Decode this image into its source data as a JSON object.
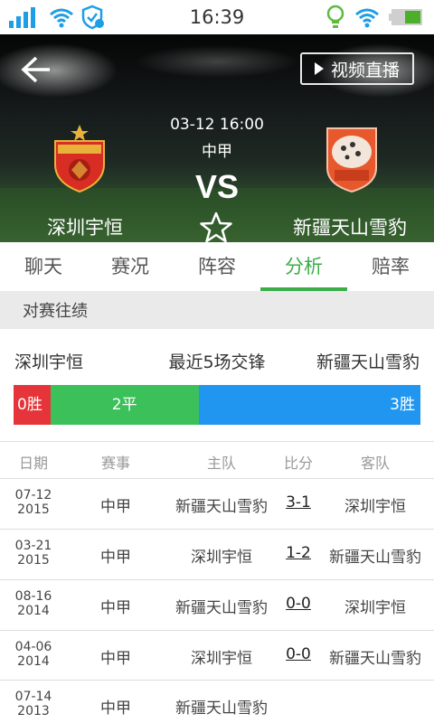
{
  "status_bar": {
    "time": "16:39"
  },
  "header": {
    "live_label": "视频直播",
    "match_time": "03-12 16:00",
    "league": "中甲",
    "vs": "VS",
    "home_team": "深圳宇恒",
    "away_team": "新疆天山雪豹"
  },
  "tabs": [
    {
      "label": "聊天",
      "active": false
    },
    {
      "label": "赛况",
      "active": false
    },
    {
      "label": "阵容",
      "active": false
    },
    {
      "label": "分析",
      "active": true
    },
    {
      "label": "赔率",
      "active": false
    }
  ],
  "section": {
    "title": "对赛往绩"
  },
  "summary": {
    "home": "深圳宇恒",
    "middle": "最近5场交锋",
    "away": "新疆天山雪豹"
  },
  "record": {
    "win_label": "0胜",
    "draw_label": "2平",
    "loss_label": "3胜",
    "wins": 0,
    "draws": 2,
    "losses": 3,
    "colors": {
      "win": "#e6353a",
      "draw": "#3cc05a",
      "loss": "#2196f0"
    }
  },
  "table": {
    "headers": {
      "date": "日期",
      "league": "赛事",
      "home": "主队",
      "score": "比分",
      "away": "客队"
    },
    "rows": [
      {
        "date_md": "07-12",
        "date_y": "2015",
        "league": "中甲",
        "home": "新疆天山雪豹",
        "score": "3-1",
        "away": "深圳宇恒"
      },
      {
        "date_md": "03-21",
        "date_y": "2015",
        "league": "中甲",
        "home": "深圳宇恒",
        "score": "1-2",
        "away": "新疆天山雪豹"
      },
      {
        "date_md": "08-16",
        "date_y": "2014",
        "league": "中甲",
        "home": "新疆天山雪豹",
        "score": "0-0",
        "away": "深圳宇恒"
      },
      {
        "date_md": "04-06",
        "date_y": "2014",
        "league": "中甲",
        "home": "深圳宇恒",
        "score": "0-0",
        "away": "新疆天山雪豹"
      },
      {
        "date_md": "07-14",
        "date_y": "2013",
        "league": "中甲",
        "home": "新疆天山雪豹",
        "score": "",
        "away": ""
      }
    ]
  },
  "theme": {
    "accent": "#3aad48",
    "status_icons": "#1e9ee6"
  }
}
